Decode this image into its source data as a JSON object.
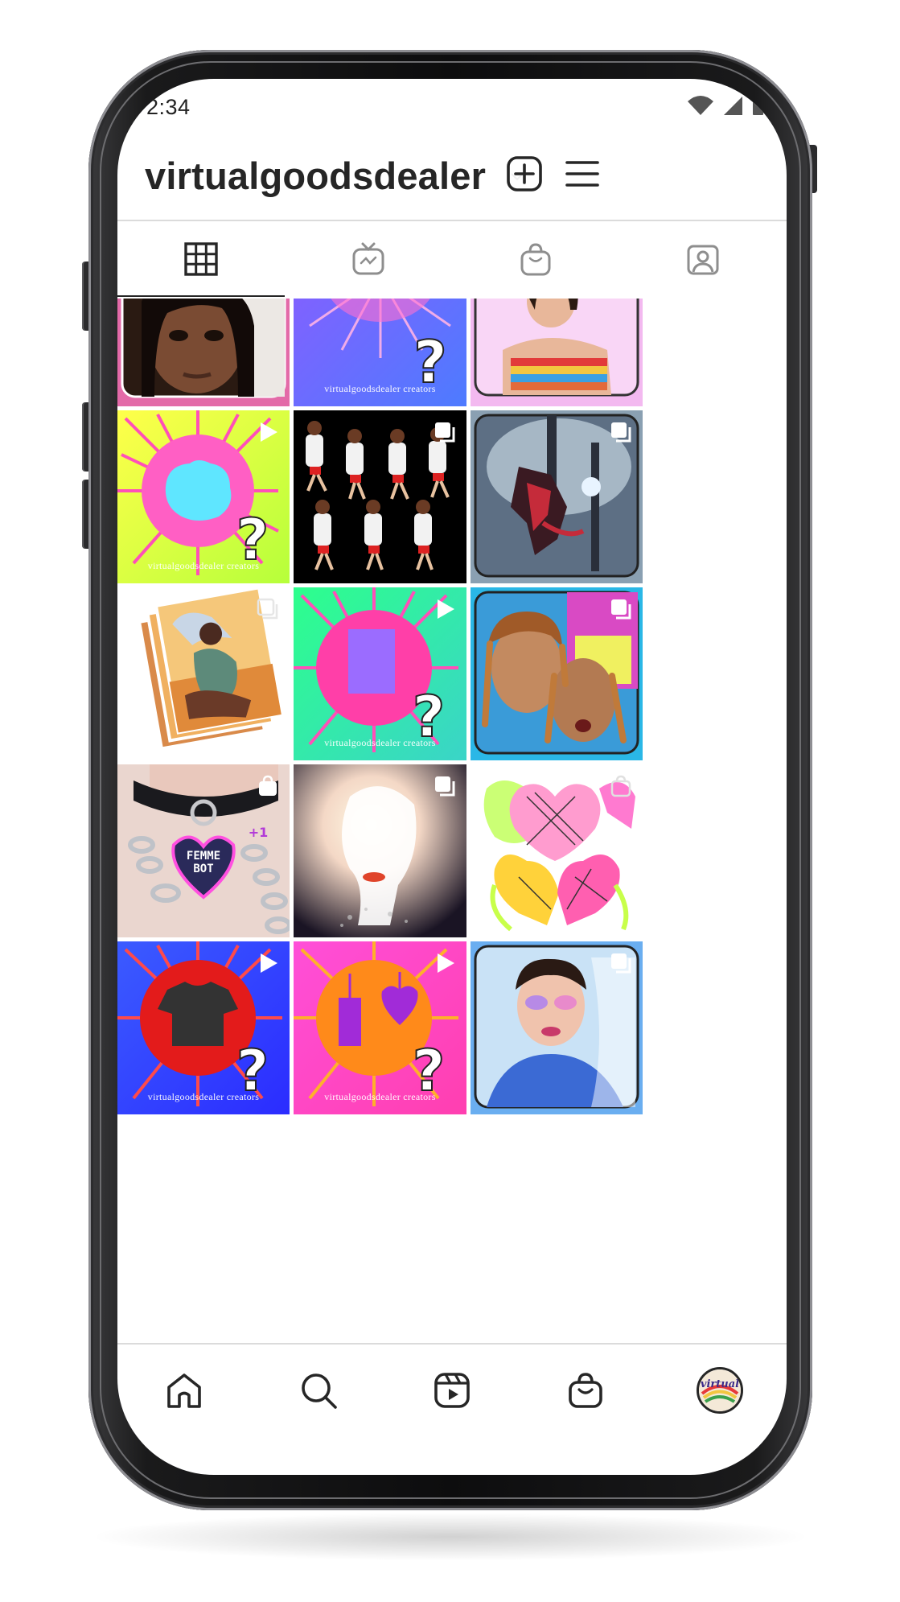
{
  "status_bar": {
    "time": "2:34"
  },
  "header": {
    "username": "virtualgoodsdealer"
  },
  "tabs": [
    {
      "id": "posts",
      "icon": "grid-icon",
      "active": true
    },
    {
      "id": "igtv",
      "icon": "igtv-icon",
      "active": false
    },
    {
      "id": "shop",
      "icon": "shopping-bag-icon",
      "active": false
    },
    {
      "id": "tagged",
      "icon": "tagged-user-icon",
      "active": false
    }
  ],
  "grid": {
    "caption_text": "virtualgoodsdealer creators",
    "colors": {
      "pink": "#ff4fb8",
      "cyan": "#57e6ff",
      "yellow": "#fbff4a",
      "green": "#66ff3d",
      "purple": "#9b5cff",
      "red": "#e31b1b",
      "blue": "#3b44ff",
      "orange": "#ff8a1a"
    }
  },
  "bottom_nav": [
    {
      "id": "home",
      "icon": "home-icon"
    },
    {
      "id": "search",
      "icon": "search-icon"
    },
    {
      "id": "reels",
      "icon": "reels-icon"
    },
    {
      "id": "shop",
      "icon": "shopping-bag-icon"
    },
    {
      "id": "profile",
      "icon": "profile-avatar",
      "avatar_text": "virtual"
    }
  ]
}
